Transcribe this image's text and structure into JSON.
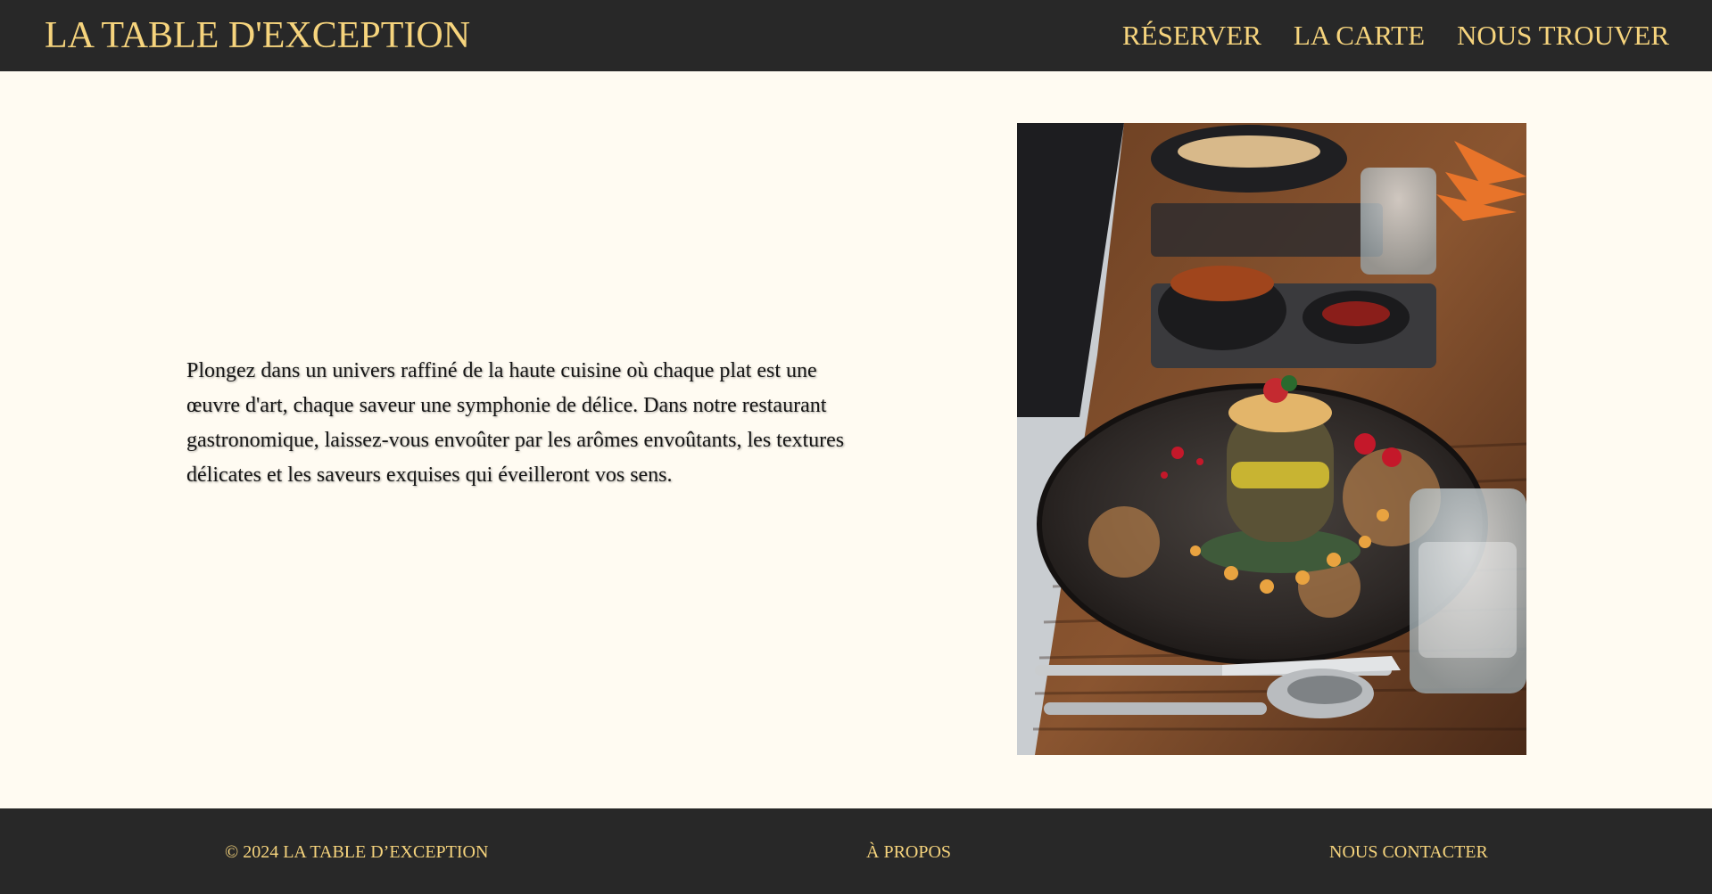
{
  "header": {
    "brand": "LA TABLE D'EXCEPTION",
    "nav": [
      {
        "label": "RÉSERVER"
      },
      {
        "label": "LA CARTE"
      },
      {
        "label": "NOUS TROUVER"
      }
    ]
  },
  "main": {
    "intro": "Plongez dans un univers raffiné de la haute cuisine où chaque plat est une œuvre d'art, chaque saveur une symphonie de délice. Dans notre restaurant gastronomique, laissez-vous envoûter par les arômes envoûtants, les textures délicates et les saveurs exquises qui éveilleront vos sens.",
    "photo_icon": "plated-dish-photo"
  },
  "footer": {
    "copyright": "© 2024 LA TABLE D’EXCEPTION",
    "about": "À PROPOS",
    "contact": "NOUS CONTACTER"
  },
  "colors": {
    "header_bg": "#282828",
    "accent_gold": "#f6d47d",
    "page_bg": "#fffbf2",
    "text": "#161616"
  }
}
